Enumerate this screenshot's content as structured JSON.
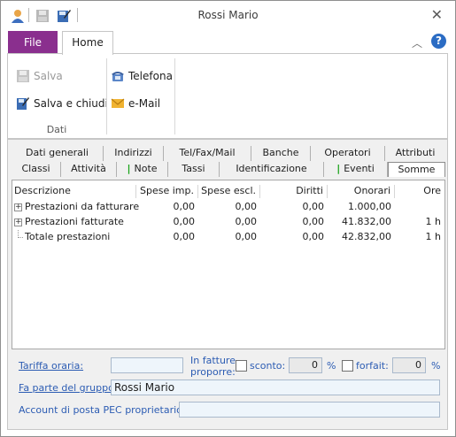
{
  "window": {
    "title": "Rossi Mario"
  },
  "ribbon": {
    "file_tab": "File",
    "home_tab": "Home",
    "group_label": "Dati",
    "buttons": {
      "salva": "Salva",
      "salva_chiudi": "Salva e chiudi",
      "telefona": "Telefona",
      "email": "e-Mail"
    }
  },
  "tabs_row1": [
    "Dati generali",
    "Indirizzi",
    "Tel/Fax/Mail",
    "Banche",
    "Operatori",
    "Attributi"
  ],
  "tabs_row2": [
    "Classi",
    "Attività",
    "Note",
    "Tassi",
    "Identificazione",
    "Eventi",
    "Somme"
  ],
  "active_tab": "Somme",
  "table": {
    "headers": [
      "Descrizione",
      "Spese imp.",
      "Spese escl.",
      "Diritti",
      "Onorari",
      "Ore"
    ],
    "rows": [
      {
        "descrizione": "Prestazioni da fatturare",
        "spese_imp": "0,00",
        "spese_escl": "0,00",
        "diritti": "0,00",
        "onorari": "1.000,00",
        "ore": ""
      },
      {
        "descrizione": "Prestazioni fatturate",
        "spese_imp": "0,00",
        "spese_escl": "0,00",
        "diritti": "0,00",
        "onorari": "41.832,00",
        "ore": "1 h"
      },
      {
        "descrizione": "Totale prestazioni",
        "spese_imp": "0,00",
        "spese_escl": "0,00",
        "diritti": "0,00",
        "onorari": "42.832,00",
        "ore": "1 h"
      }
    ]
  },
  "form": {
    "tariffa_label": "Tariffa oraria:",
    "tariffa_value": "",
    "in_fatture_label_1": "In fatture",
    "in_fatture_label_2": "proporre:",
    "sconto_label": "sconto:",
    "sconto_value": "0",
    "forfait_label": "forfait:",
    "forfait_value": "0",
    "percent": "%",
    "gruppo_label": "Fa parte del gruppo:",
    "gruppo_value": "Rossi Mario",
    "pec_label": "Account di posta PEC proprietario:",
    "pec_value": ""
  },
  "colors": {
    "file_tab": "#8a2f8e",
    "label_blue": "#2c5cb3",
    "field_bg": "#eef5fb",
    "help_icon": "#2b6cc4",
    "note_marker": "#17a317"
  }
}
